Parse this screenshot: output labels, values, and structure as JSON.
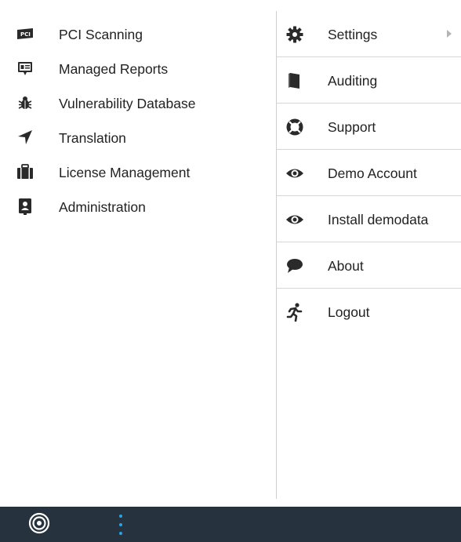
{
  "left_menu": {
    "items": [
      {
        "label": "PCI Scanning",
        "icon": "pci-icon"
      },
      {
        "label": "Managed Reports",
        "icon": "report-icon"
      },
      {
        "label": "Vulnerability Database",
        "icon": "bug-icon"
      },
      {
        "label": "Translation",
        "icon": "location-arrow-icon"
      },
      {
        "label": "License Management",
        "icon": "briefcase-icon"
      },
      {
        "label": "Administration",
        "icon": "admin-icon"
      }
    ]
  },
  "right_menu": {
    "items": [
      {
        "label": "Settings",
        "icon": "gear-icon",
        "has_submenu": true
      },
      {
        "label": "Auditing",
        "icon": "book-icon"
      },
      {
        "label": "Support",
        "icon": "lifebuoy-icon"
      },
      {
        "label": "Demo Account",
        "icon": "eye-icon"
      },
      {
        "label": "Install demodata",
        "icon": "eye-icon"
      },
      {
        "label": "About",
        "icon": "speech-bubble-icon"
      },
      {
        "label": "Logout",
        "icon": "running-man-icon"
      }
    ]
  },
  "taskbar": {
    "logo_icon": "target-logo-icon",
    "menu_icon": "vertical-dots-icon"
  },
  "colors": {
    "taskbar_bg": "#26323d",
    "accent": "#29a3e6",
    "icon": "#2a2a2a",
    "divider": "#d6d6d6"
  }
}
